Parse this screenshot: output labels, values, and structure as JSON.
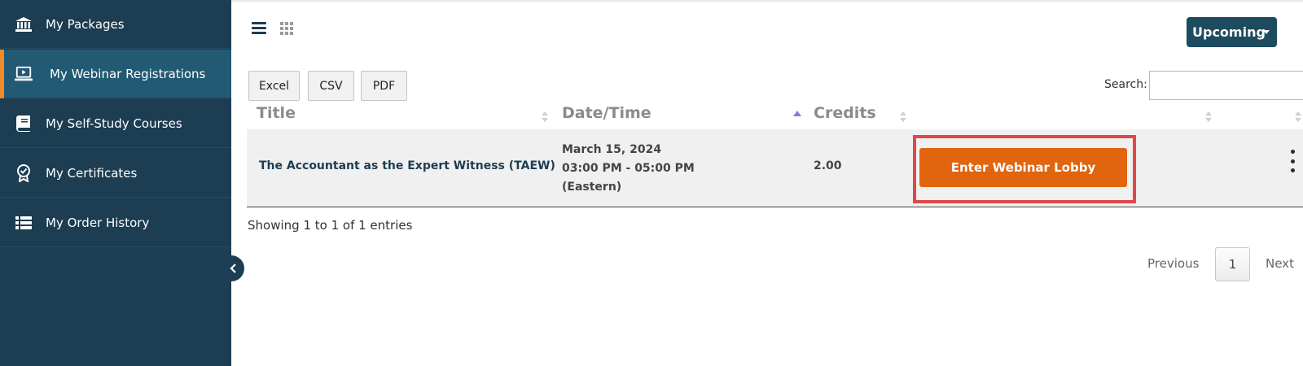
{
  "sidebar": {
    "items": [
      {
        "label": "My Packages",
        "icon": "bank-icon"
      },
      {
        "label": "My Webinar Registrations",
        "icon": "laptop-play-icon"
      },
      {
        "label": "My Self-Study Courses",
        "icon": "book-icon"
      },
      {
        "label": "My Certificates",
        "icon": "award-icon"
      },
      {
        "label": "My Order History",
        "icon": "list-icon"
      }
    ]
  },
  "toolbar": {
    "filter_label": "Upcoming",
    "export_buttons": [
      "Excel",
      "CSV",
      "PDF"
    ],
    "search_label": "Search:",
    "search_value": ""
  },
  "table": {
    "headers": [
      "Title",
      "Date/Time",
      "Credits"
    ],
    "rows": [
      {
        "title": "The Accountant as the Expert Witness (TAEW)",
        "date": "March 15, 2024",
        "time": "03:00 PM - 05:00 PM",
        "zone": "(Eastern)",
        "credits": "2.00",
        "action": "Enter Webinar Lobby"
      }
    ]
  },
  "footer": {
    "entries": "Showing 1 to 1 of 1 entries",
    "previous": "Previous",
    "page": "1",
    "next": "Next"
  },
  "colors": {
    "sidebar_bg": "#1c3d52",
    "active_item_bg": "#225a73",
    "active_accent": "#ef8a2a",
    "primary_button": "#e0650e",
    "filter_button": "#1d4b5f",
    "highlight": "#e04848"
  }
}
